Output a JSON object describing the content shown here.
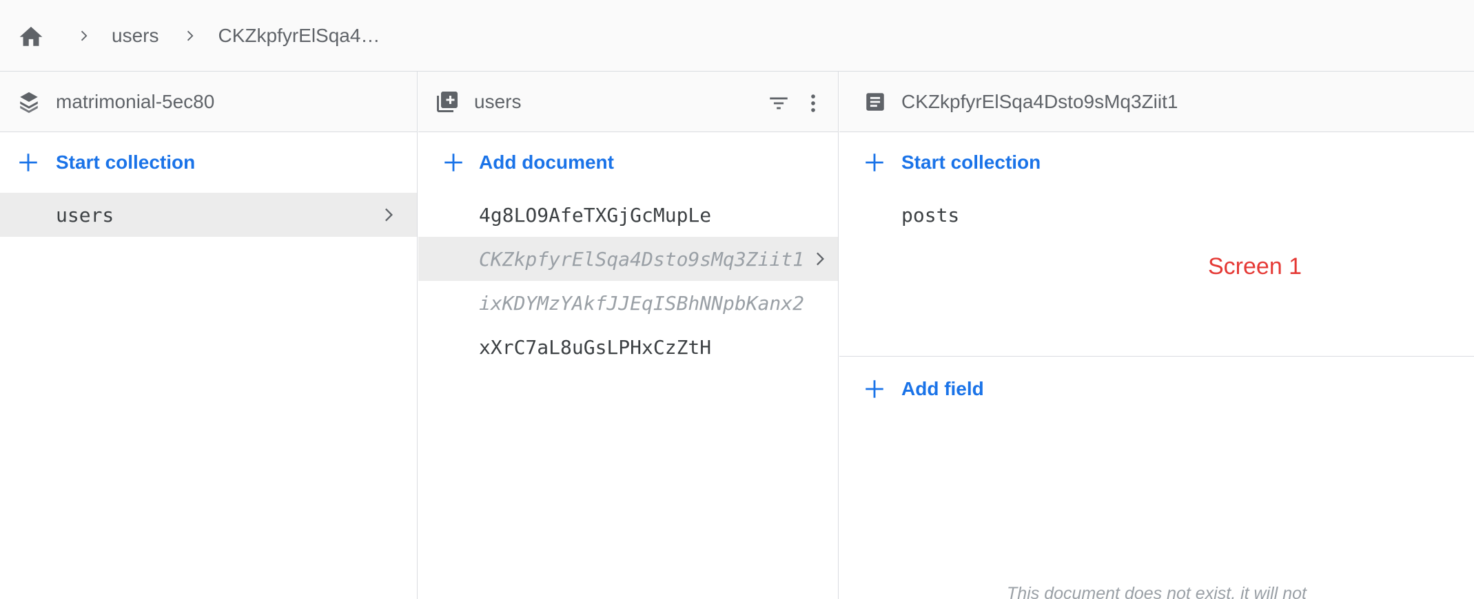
{
  "breadcrumb": {
    "items": [
      "users",
      "CKZkpfyrElSqa4…"
    ]
  },
  "icons": {
    "home": "home-icon",
    "chevron": "chevron-right-icon",
    "database": "database-stack-icon",
    "collection": "collection-icon",
    "document": "document-icon",
    "plus": "plus-icon",
    "filter": "filter-icon",
    "more": "more-vert-icon"
  },
  "colors": {
    "accent": "#1a73e8",
    "label_red": "#e53935",
    "selected_bg": "#ececec",
    "header_bg": "#fafafa"
  },
  "root_panel": {
    "title": "matrimonial-5ec80",
    "action_label": "Start collection",
    "items": [
      {
        "label": "users",
        "selected": true
      }
    ]
  },
  "collection_panel": {
    "title": "users",
    "action_label": "Add document",
    "items": [
      {
        "label": "4g8LO9AfeTXGjGcMupLe",
        "ghost": false,
        "selected": false
      },
      {
        "label": "CKZkpfyrElSqa4Dsto9sMq3Ziit1",
        "ghost": true,
        "selected": true
      },
      {
        "label": "ixKDYMzYAkfJJEqISBhNNpbKanx2",
        "ghost": true,
        "selected": false
      },
      {
        "label": "xXrC7aL8uGsLPHxCzZtH",
        "ghost": false,
        "selected": false
      }
    ]
  },
  "document_panel": {
    "title": "CKZkpfyrElSqa4Dsto9sMq3Ziit1",
    "action_label": "Start collection",
    "subcollections": [
      {
        "label": "posts"
      }
    ],
    "add_field_label": "Add field",
    "notice": "This document does not exist, it will not"
  },
  "annotation": {
    "label": "Screen 1"
  }
}
